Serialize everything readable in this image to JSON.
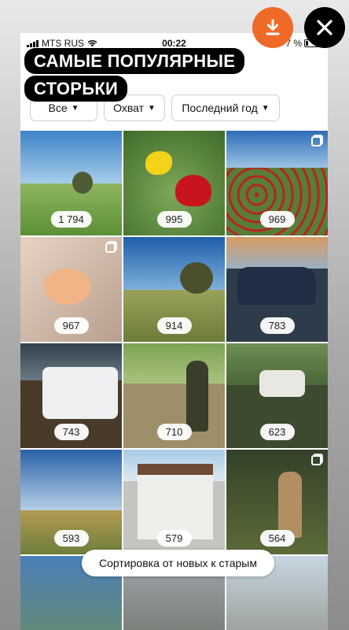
{
  "status_bar": {
    "carrier": "MTS RUS",
    "time": "00:22",
    "battery": "7 %"
  },
  "story": {
    "title": "САМЫЕ ПОПУЛЯРНЫЕ СТОРЬКИ"
  },
  "filters": [
    {
      "label": "Все"
    },
    {
      "label": "Охват"
    },
    {
      "label": "Последний год"
    }
  ],
  "icons": {
    "download": "download-icon",
    "close": "close-icon",
    "chevron": "chevron-down-icon",
    "multi": "multiple-photos-icon"
  },
  "colors": {
    "accent": "#f06a27",
    "overlay_title_bg": "#000000"
  },
  "grid": {
    "tiles": [
      {
        "count": "1 794",
        "subject": "steppe with tree and yurts"
      },
      {
        "count": "995",
        "subject": "yellow and red tulips"
      },
      {
        "count": "969",
        "subject": "red tulip field"
      },
      {
        "count": "967",
        "subject": "baby in peach dress"
      },
      {
        "count": "914",
        "subject": "lone tree on hill"
      },
      {
        "count": "783",
        "subject": "blue lexus suv"
      },
      {
        "count": "743",
        "subject": "man with white jeep"
      },
      {
        "count": "710",
        "subject": "man on dirt road"
      },
      {
        "count": "623",
        "subject": "white jeep in forest"
      },
      {
        "count": "593",
        "subject": "observatory on hills"
      },
      {
        "count": "579",
        "subject": "white brick house"
      },
      {
        "count": "564",
        "subject": "man in forest"
      },
      {
        "count": "",
        "subject": "mountain valley"
      },
      {
        "count": "",
        "subject": "hazy landscape"
      },
      {
        "count": "",
        "subject": "city buildings"
      }
    ]
  },
  "sort_toast": {
    "label": "Сортировка от новых к старым"
  }
}
